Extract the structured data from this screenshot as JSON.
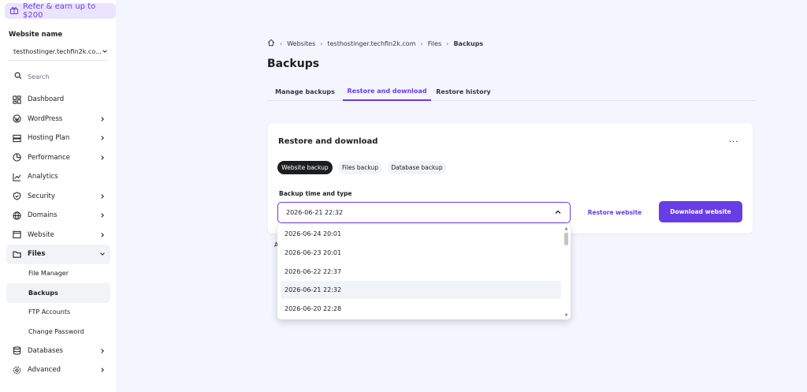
{
  "sidebar": {
    "refer_label": "Refer & earn up to $200",
    "site_label": "Website name",
    "site_value": "testhostinger.techfin2k.co...",
    "search_placeholder": "Search",
    "items": [
      {
        "label": "Dashboard",
        "icon": "dashboard-icon",
        "chevron": false
      },
      {
        "label": "WordPress",
        "icon": "wordpress-icon",
        "chevron": true
      },
      {
        "label": "Hosting Plan",
        "icon": "server-icon",
        "chevron": true
      },
      {
        "label": "Performance",
        "icon": "gauge-icon",
        "chevron": true
      },
      {
        "label": "Analytics",
        "icon": "analytics-icon",
        "chevron": false
      },
      {
        "label": "Security",
        "icon": "shield-icon",
        "chevron": true
      },
      {
        "label": "Domains",
        "icon": "globe-icon",
        "chevron": true
      },
      {
        "label": "Website",
        "icon": "browser-icon",
        "chevron": true
      },
      {
        "label": "Files",
        "icon": "folder-icon",
        "chevron": true,
        "open": true
      }
    ],
    "sub_items": [
      "File Manager",
      "Backups",
      "FTP Accounts",
      "Change Password"
    ],
    "items_after": [
      {
        "label": "Databases",
        "icon": "database-icon",
        "chevron": true
      },
      {
        "label": "Advanced",
        "icon": "gear-icon",
        "chevron": true
      }
    ]
  },
  "breadcrumb": {
    "items": [
      "Websites",
      "testhostinger.techfin2k.com",
      "Files"
    ],
    "current": "Backups"
  },
  "page": {
    "title": "Backups",
    "tabs": [
      "Manage backups",
      "Restore and download",
      "Restore history"
    ],
    "active_tab": "Restore and download"
  },
  "card": {
    "title": "Restore and download",
    "more": "···",
    "chips": [
      "Website backup",
      "Files backup",
      "Database backup"
    ],
    "active_chip": "Website backup",
    "field_label": "Backup time and type",
    "selected_value": "2026-06-21 22:32",
    "restore_label": "Restore website",
    "download_label": "Download website",
    "partial_text": "A"
  },
  "dropdown": {
    "options": [
      "2026-06-24 20:01",
      "2026-06-23 20:01",
      "2026-06-22 22:37",
      "2026-06-21 22:32",
      "2026-06-20 22:28"
    ],
    "selected": "2026-06-21 22:32"
  },
  "colors": {
    "accent": "#673de6",
    "accent_light": "#ebe4ff",
    "background": "#f4f5ff",
    "text": "#1d1e20"
  }
}
